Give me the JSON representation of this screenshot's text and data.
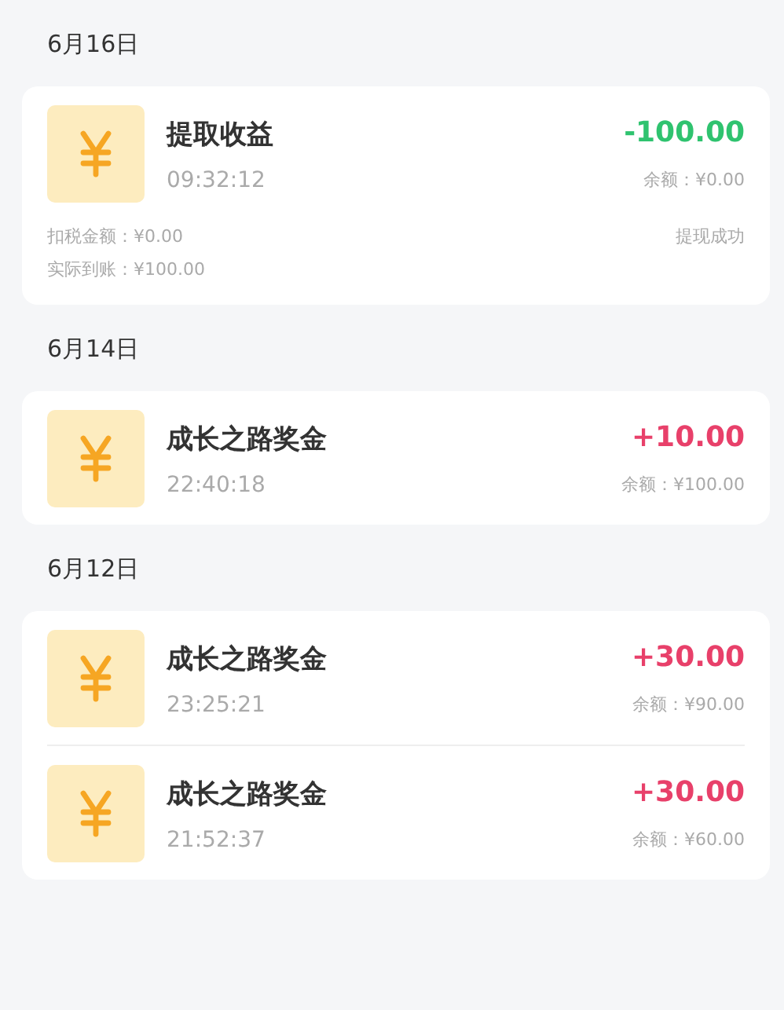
{
  "groups": [
    {
      "date": "6月16日",
      "records": [
        {
          "title": "提取收益",
          "time": "09:32:12",
          "amount": "-100.00",
          "kind": "debit",
          "balance": "余额：¥0.00",
          "details": [
            "扣税金额：¥0.00",
            "实际到账：¥100.00"
          ],
          "status": "提现成功"
        }
      ]
    },
    {
      "date": "6月14日",
      "records": [
        {
          "title": "成长之路奖金",
          "time": "22:40:18",
          "amount": "+10.00",
          "kind": "credit",
          "balance": "余额：¥100.00"
        }
      ]
    },
    {
      "date": "6月12日",
      "records": [
        {
          "title": "成长之路奖金",
          "time": "23:25:21",
          "amount": "+30.00",
          "kind": "credit",
          "balance": "余额：¥90.00"
        },
        {
          "title": "成长之路奖金",
          "time": "21:52:37",
          "amount": "+30.00",
          "kind": "credit",
          "balance": "余额：¥60.00"
        }
      ]
    }
  ]
}
